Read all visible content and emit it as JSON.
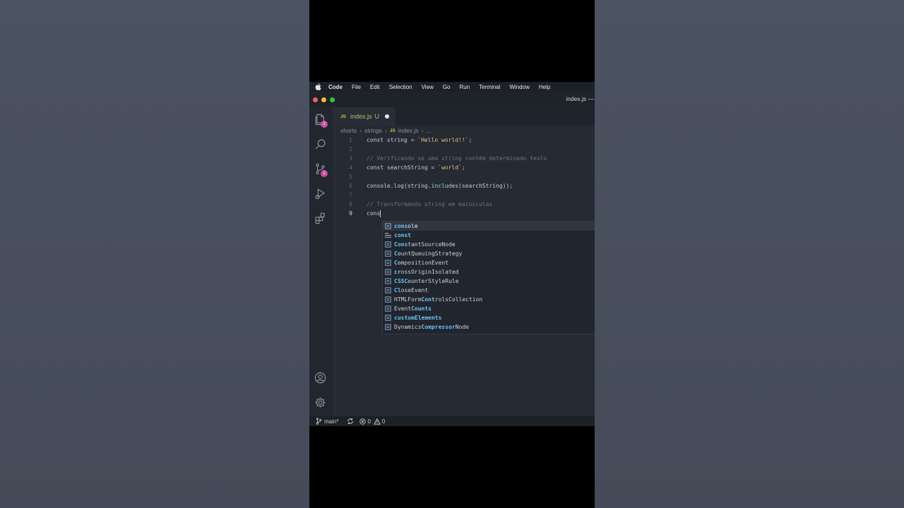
{
  "menubar": {
    "app": "Code",
    "items": [
      "File",
      "Edit",
      "Selection",
      "View",
      "Go",
      "Run",
      "Terminal",
      "Window",
      "Help"
    ]
  },
  "window": {
    "title": "index.js —"
  },
  "activity_bar": {
    "explorer_badge": "1",
    "source_control_badge": "1"
  },
  "tab": {
    "lang_badge": "JS",
    "filename": "index.js",
    "status": "U"
  },
  "breadcrumb": {
    "folder1": "shorts",
    "folder2": "strings",
    "lang_badge": "JS",
    "file": "index.js",
    "more": "..."
  },
  "editor": {
    "line_numbers": [
      "1",
      "2",
      "3",
      "4",
      "5",
      "6",
      "7",
      "8",
      "9"
    ],
    "active_line": 9,
    "lines": {
      "l1": {
        "kw": "const string = ",
        "str": "`Hello world!!`",
        "end": ";"
      },
      "l3": {
        "comment": "// Verificando se uma string contém determinado texto"
      },
      "l4": {
        "kw": "const searchString = ",
        "str": "`world`",
        "end": ";"
      },
      "l6": {
        "p1": "console.",
        "f1": "log",
        "p2": "(string.",
        "f2": "includes",
        "p3": "(searchString));"
      },
      "l8": {
        "comment": "// Transformando string em maiúsculas"
      },
      "l9": {
        "typed": "cons"
      }
    }
  },
  "suggestions": {
    "items": [
      {
        "hl": "cons",
        "rest": "ole",
        "kind": "variable"
      },
      {
        "hl": "const",
        "rest": "",
        "kind": "keyword"
      },
      {
        "hl": "Cons",
        "rest": "tantSourceNode",
        "kind": "variable"
      },
      {
        "pre": "",
        "hl": "Co",
        "rest": "untQueuingStrategy",
        "kind": "variable"
      },
      {
        "pre": "",
        "hl": "Co",
        "rest": "mpositionEvent",
        "kind": "variable"
      },
      {
        "pre": "",
        "hl": "cr",
        "rest": "ossOriginIsolated",
        "kind": "variable"
      },
      {
        "pre": "",
        "hl": "CSSCo",
        "rest": "unterStyleRule",
        "kind": "variable"
      },
      {
        "pre": "",
        "hl": "Cl",
        "rest": "oseEvent",
        "kind": "variable"
      },
      {
        "pre": "HTMLForm",
        "hl": "Cont",
        "rest": "rolsCollection",
        "kind": "variable"
      },
      {
        "pre": "Event",
        "hl": "Counts",
        "rest": "",
        "kind": "variable"
      },
      {
        "pre": "",
        "hl": "customElements",
        "rest": "",
        "kind": "variable"
      },
      {
        "pre": "Dynamics",
        "hl": "Compressor",
        "rest": "Node",
        "kind": "variable"
      }
    ],
    "labels": [
      "console",
      "const",
      "ConstantSourceNode",
      "CountQueuingStrategy",
      "CompositionEvent",
      "crossOriginIsolated",
      "CSSCounterStyleRule",
      "CloseEvent",
      "HTMLFormControlsCollection",
      "EventCounts",
      "customElements",
      "DynamicsCompressorNode"
    ]
  },
  "statusbar": {
    "branch": "main*",
    "errors": "0",
    "warnings": "0"
  }
}
